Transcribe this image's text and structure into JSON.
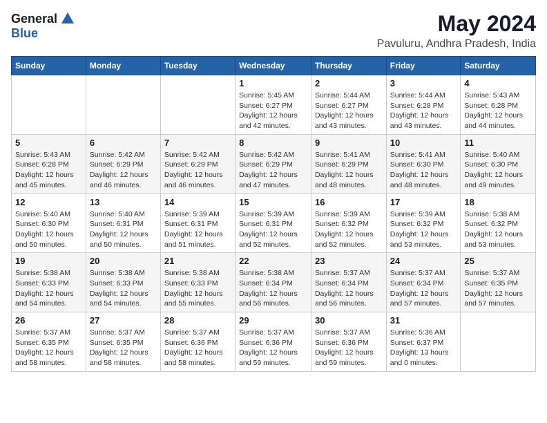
{
  "logo": {
    "general": "General",
    "blue": "Blue"
  },
  "title": "May 2024",
  "location": "Pavuluru, Andhra Pradesh, India",
  "weekdays": [
    "Sunday",
    "Monday",
    "Tuesday",
    "Wednesday",
    "Thursday",
    "Friday",
    "Saturday"
  ],
  "weeks": [
    [
      {
        "day": "",
        "sunrise": "",
        "sunset": "",
        "daylight": ""
      },
      {
        "day": "",
        "sunrise": "",
        "sunset": "",
        "daylight": ""
      },
      {
        "day": "",
        "sunrise": "",
        "sunset": "",
        "daylight": ""
      },
      {
        "day": "1",
        "sunrise": "Sunrise: 5:45 AM",
        "sunset": "Sunset: 6:27 PM",
        "daylight": "Daylight: 12 hours and 42 minutes."
      },
      {
        "day": "2",
        "sunrise": "Sunrise: 5:44 AM",
        "sunset": "Sunset: 6:27 PM",
        "daylight": "Daylight: 12 hours and 43 minutes."
      },
      {
        "day": "3",
        "sunrise": "Sunrise: 5:44 AM",
        "sunset": "Sunset: 6:28 PM",
        "daylight": "Daylight: 12 hours and 43 minutes."
      },
      {
        "day": "4",
        "sunrise": "Sunrise: 5:43 AM",
        "sunset": "Sunset: 6:28 PM",
        "daylight": "Daylight: 12 hours and 44 minutes."
      }
    ],
    [
      {
        "day": "5",
        "sunrise": "Sunrise: 5:43 AM",
        "sunset": "Sunset: 6:28 PM",
        "daylight": "Daylight: 12 hours and 45 minutes."
      },
      {
        "day": "6",
        "sunrise": "Sunrise: 5:42 AM",
        "sunset": "Sunset: 6:29 PM",
        "daylight": "Daylight: 12 hours and 46 minutes."
      },
      {
        "day": "7",
        "sunrise": "Sunrise: 5:42 AM",
        "sunset": "Sunset: 6:29 PM",
        "daylight": "Daylight: 12 hours and 46 minutes."
      },
      {
        "day": "8",
        "sunrise": "Sunrise: 5:42 AM",
        "sunset": "Sunset: 6:29 PM",
        "daylight": "Daylight: 12 hours and 47 minutes."
      },
      {
        "day": "9",
        "sunrise": "Sunrise: 5:41 AM",
        "sunset": "Sunset: 6:29 PM",
        "daylight": "Daylight: 12 hours and 48 minutes."
      },
      {
        "day": "10",
        "sunrise": "Sunrise: 5:41 AM",
        "sunset": "Sunset: 6:30 PM",
        "daylight": "Daylight: 12 hours and 48 minutes."
      },
      {
        "day": "11",
        "sunrise": "Sunrise: 5:40 AM",
        "sunset": "Sunset: 6:30 PM",
        "daylight": "Daylight: 12 hours and 49 minutes."
      }
    ],
    [
      {
        "day": "12",
        "sunrise": "Sunrise: 5:40 AM",
        "sunset": "Sunset: 6:30 PM",
        "daylight": "Daylight: 12 hours and 50 minutes."
      },
      {
        "day": "13",
        "sunrise": "Sunrise: 5:40 AM",
        "sunset": "Sunset: 6:31 PM",
        "daylight": "Daylight: 12 hours and 50 minutes."
      },
      {
        "day": "14",
        "sunrise": "Sunrise: 5:39 AM",
        "sunset": "Sunset: 6:31 PM",
        "daylight": "Daylight: 12 hours and 51 minutes."
      },
      {
        "day": "15",
        "sunrise": "Sunrise: 5:39 AM",
        "sunset": "Sunset: 6:31 PM",
        "daylight": "Daylight: 12 hours and 52 minutes."
      },
      {
        "day": "16",
        "sunrise": "Sunrise: 5:39 AM",
        "sunset": "Sunset: 6:32 PM",
        "daylight": "Daylight: 12 hours and 52 minutes."
      },
      {
        "day": "17",
        "sunrise": "Sunrise: 5:39 AM",
        "sunset": "Sunset: 6:32 PM",
        "daylight": "Daylight: 12 hours and 53 minutes."
      },
      {
        "day": "18",
        "sunrise": "Sunrise: 5:38 AM",
        "sunset": "Sunset: 6:32 PM",
        "daylight": "Daylight: 12 hours and 53 minutes."
      }
    ],
    [
      {
        "day": "19",
        "sunrise": "Sunrise: 5:38 AM",
        "sunset": "Sunset: 6:33 PM",
        "daylight": "Daylight: 12 hours and 54 minutes."
      },
      {
        "day": "20",
        "sunrise": "Sunrise: 5:38 AM",
        "sunset": "Sunset: 6:33 PM",
        "daylight": "Daylight: 12 hours and 54 minutes."
      },
      {
        "day": "21",
        "sunrise": "Sunrise: 5:38 AM",
        "sunset": "Sunset: 6:33 PM",
        "daylight": "Daylight: 12 hours and 55 minutes."
      },
      {
        "day": "22",
        "sunrise": "Sunrise: 5:38 AM",
        "sunset": "Sunset: 6:34 PM",
        "daylight": "Daylight: 12 hours and 56 minutes."
      },
      {
        "day": "23",
        "sunrise": "Sunrise: 5:37 AM",
        "sunset": "Sunset: 6:34 PM",
        "daylight": "Daylight: 12 hours and 56 minutes."
      },
      {
        "day": "24",
        "sunrise": "Sunrise: 5:37 AM",
        "sunset": "Sunset: 6:34 PM",
        "daylight": "Daylight: 12 hours and 57 minutes."
      },
      {
        "day": "25",
        "sunrise": "Sunrise: 5:37 AM",
        "sunset": "Sunset: 6:35 PM",
        "daylight": "Daylight: 12 hours and 57 minutes."
      }
    ],
    [
      {
        "day": "26",
        "sunrise": "Sunrise: 5:37 AM",
        "sunset": "Sunset: 6:35 PM",
        "daylight": "Daylight: 12 hours and 58 minutes."
      },
      {
        "day": "27",
        "sunrise": "Sunrise: 5:37 AM",
        "sunset": "Sunset: 6:35 PM",
        "daylight": "Daylight: 12 hours and 58 minutes."
      },
      {
        "day": "28",
        "sunrise": "Sunrise: 5:37 AM",
        "sunset": "Sunset: 6:36 PM",
        "daylight": "Daylight: 12 hours and 58 minutes."
      },
      {
        "day": "29",
        "sunrise": "Sunrise: 5:37 AM",
        "sunset": "Sunset: 6:36 PM",
        "daylight": "Daylight: 12 hours and 59 minutes."
      },
      {
        "day": "30",
        "sunrise": "Sunrise: 5:37 AM",
        "sunset": "Sunset: 6:36 PM",
        "daylight": "Daylight: 12 hours and 59 minutes."
      },
      {
        "day": "31",
        "sunrise": "Sunrise: 5:36 AM",
        "sunset": "Sunset: 6:37 PM",
        "daylight": "Daylight: 13 hours and 0 minutes."
      },
      {
        "day": "",
        "sunrise": "",
        "sunset": "",
        "daylight": ""
      }
    ]
  ]
}
